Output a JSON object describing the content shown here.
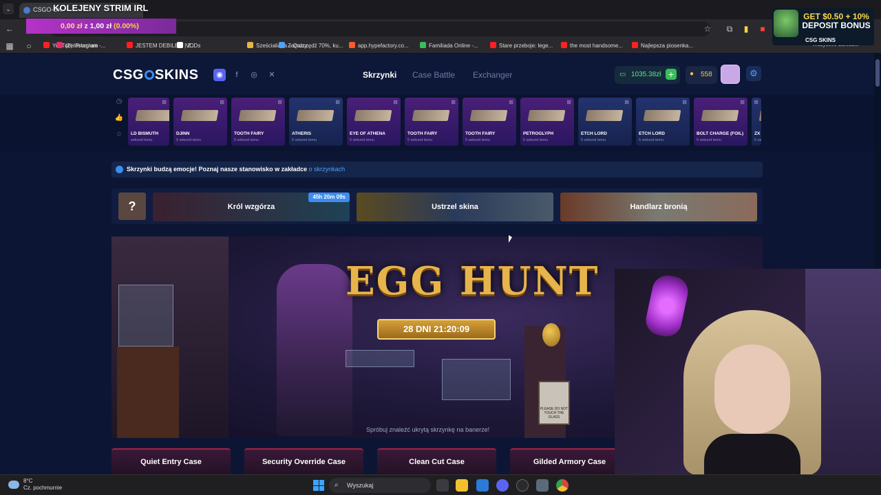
{
  "browser": {
    "tab_title": "CSGO-SK",
    "overlay_title": "KOLEJENY STRIM IRL",
    "price_overlay": {
      "amount": "0,00 zł",
      "sep": "z",
      "goal": "1,00 zł",
      "pct": "(0.00%)"
    },
    "bookmarks": [
      {
        "label": "YouTube Premium -...",
        "color": "#ff2020"
      },
      {
        "label": "(2) Instagram",
        "color": "#e1306c"
      },
      {
        "label": "JESTEM DEBILEM | Z...",
        "color": "#ff2020"
      },
      {
        "label": "VODs",
        "color": "#ffffff"
      },
      {
        "label": "Sześcialiada – Quizy...",
        "color": "#e6b44a"
      },
      {
        "label": "Zaoszczędź 70%, ku...",
        "color": "#4aa3ff"
      },
      {
        "label": "app.hypefactory.co...",
        "color": "#ff5a2a"
      },
      {
        "label": "Familiada Online -...",
        "color": "#37c05a"
      },
      {
        "label": "Stare przeboje: lege...",
        "color": "#ff2020"
      },
      {
        "label": "the most handsome...",
        "color": "#ff2020"
      },
      {
        "label": "Najlepsza piosenka...",
        "color": "#ff2020"
      }
    ],
    "bookmarks_overflow": "Wszystkie zakładki"
  },
  "ad": {
    "line1": "GET $0.50 + 10%",
    "line2": "DEPOSIT BONUS",
    "logo": "CSG SKINS"
  },
  "site": {
    "logo_left": "CSG",
    "logo_right": "SKINS",
    "nav": [
      "Skrzynki",
      "Case Battle",
      "Exchanger"
    ],
    "balance": "1035.38zł",
    "coins": "558",
    "live_drops": [
      {
        "name": "LD BISMUTH",
        "time": "sekund temu",
        "tone": "purple"
      },
      {
        "name": "DJINN",
        "time": "5 sekund temu",
        "tone": "purple"
      },
      {
        "name": "TOOTH FAIRY",
        "time": "5 sekund temu",
        "tone": "purple"
      },
      {
        "name": "ATHERIS",
        "time": "5 sekund temu",
        "tone": "blue"
      },
      {
        "name": "EYE OF ATHENA",
        "time": "5 sekund temu",
        "tone": "purple"
      },
      {
        "name": "TOOTH FAIRY",
        "time": "5 sekund temu",
        "tone": "purple"
      },
      {
        "name": "TOOTH FAIRY",
        "time": "5 sekund temu",
        "tone": "purple"
      },
      {
        "name": "PETROGLYPH",
        "time": "5 sekund temu",
        "tone": "purple"
      },
      {
        "name": "ETCH LORD",
        "time": "5 sekund temu",
        "tone": "blue"
      },
      {
        "name": "ETCH LORD",
        "time": "5 sekund temu",
        "tone": "blue"
      },
      {
        "name": "BOLT CHARGE (FOIL)",
        "time": "6 sekund temu",
        "tone": "purple"
      },
      {
        "name": "ZX S",
        "time": "6 se",
        "tone": "blue"
      }
    ],
    "notice": {
      "text": "Skrzynki budzą emocje! Poznaj nasze stanowisko w zakładce",
      "link": "o skrzynkach"
    },
    "promos": [
      {
        "label": "Król wzgórza",
        "badge": "45h 20m 09s"
      },
      {
        "label": "Ustrzel skina"
      },
      {
        "label": "Handlarz bronią"
      }
    ],
    "promo_q": "?",
    "banner": {
      "title": "EGG HUNT",
      "timer": "28 DNI 21:20:09",
      "hint": "Spróbuj znaleźć ukrytą skrzynkę na banerze!",
      "sign": "PLEASE DO NOT TOUCH THE GLASS"
    },
    "cases": [
      "Quiet Entry Case",
      "Security Override Case",
      "Clean Cut Case",
      "Gilded Armory Case"
    ]
  },
  "taskbar": {
    "temp": "8°C",
    "weather": "Cz. pochmurnie",
    "search": "Wyszukaj"
  }
}
